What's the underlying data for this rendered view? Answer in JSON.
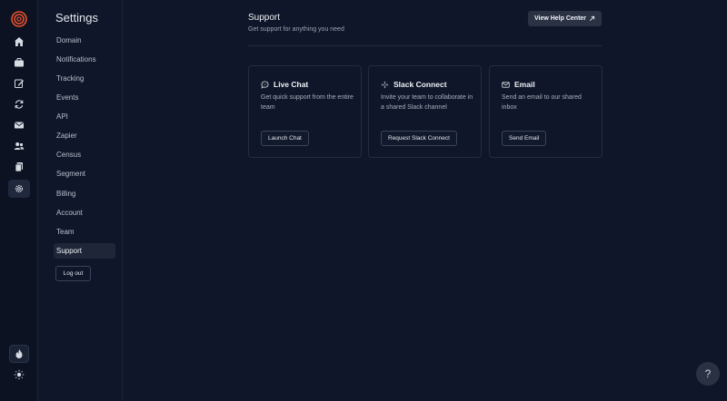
{
  "rail": {
    "items": [
      {
        "icon": "home-icon"
      },
      {
        "icon": "briefcase-icon"
      },
      {
        "icon": "edit-icon"
      },
      {
        "icon": "refresh-icon"
      },
      {
        "icon": "mail-icon"
      },
      {
        "icon": "users-icon"
      },
      {
        "icon": "documents-icon"
      },
      {
        "icon": "settings-icon",
        "active": true
      }
    ],
    "bottom": [
      {
        "icon": "flame-icon"
      },
      {
        "icon": "sun-icon"
      }
    ]
  },
  "sidebar": {
    "title": "Settings",
    "items": [
      {
        "label": "Domain"
      },
      {
        "label": "Notifications"
      },
      {
        "label": "Tracking"
      },
      {
        "label": "Events"
      },
      {
        "label": "API"
      },
      {
        "label": "Zapier"
      },
      {
        "label": "Census"
      },
      {
        "label": "Segment"
      },
      {
        "label": "Billing"
      },
      {
        "label": "Account"
      },
      {
        "label": "Team"
      },
      {
        "label": "Support",
        "active": true
      }
    ],
    "logout_label": "Log out"
  },
  "main": {
    "title": "Support",
    "subtitle": "Get support for anything you need",
    "help_button_label": "View Help Center",
    "cards": [
      {
        "icon": "chat-icon",
        "title": "Live Chat",
        "description": "Get quick support from the entire team",
        "button_label": "Launch Chat"
      },
      {
        "icon": "slack-icon",
        "title": "Slack Connect",
        "description": "Invite your team to collaborate in a shared Slack channel",
        "button_label": "Request Slack Connect"
      },
      {
        "icon": "mail-icon",
        "title": "Email",
        "description": "Send an email to our shared inbox",
        "button_label": "Send Email"
      }
    ]
  },
  "help_fab_label": "?",
  "colors": {
    "background": "#0f1629",
    "rail": "#0c1222",
    "accent_logo": "#e8512f"
  }
}
